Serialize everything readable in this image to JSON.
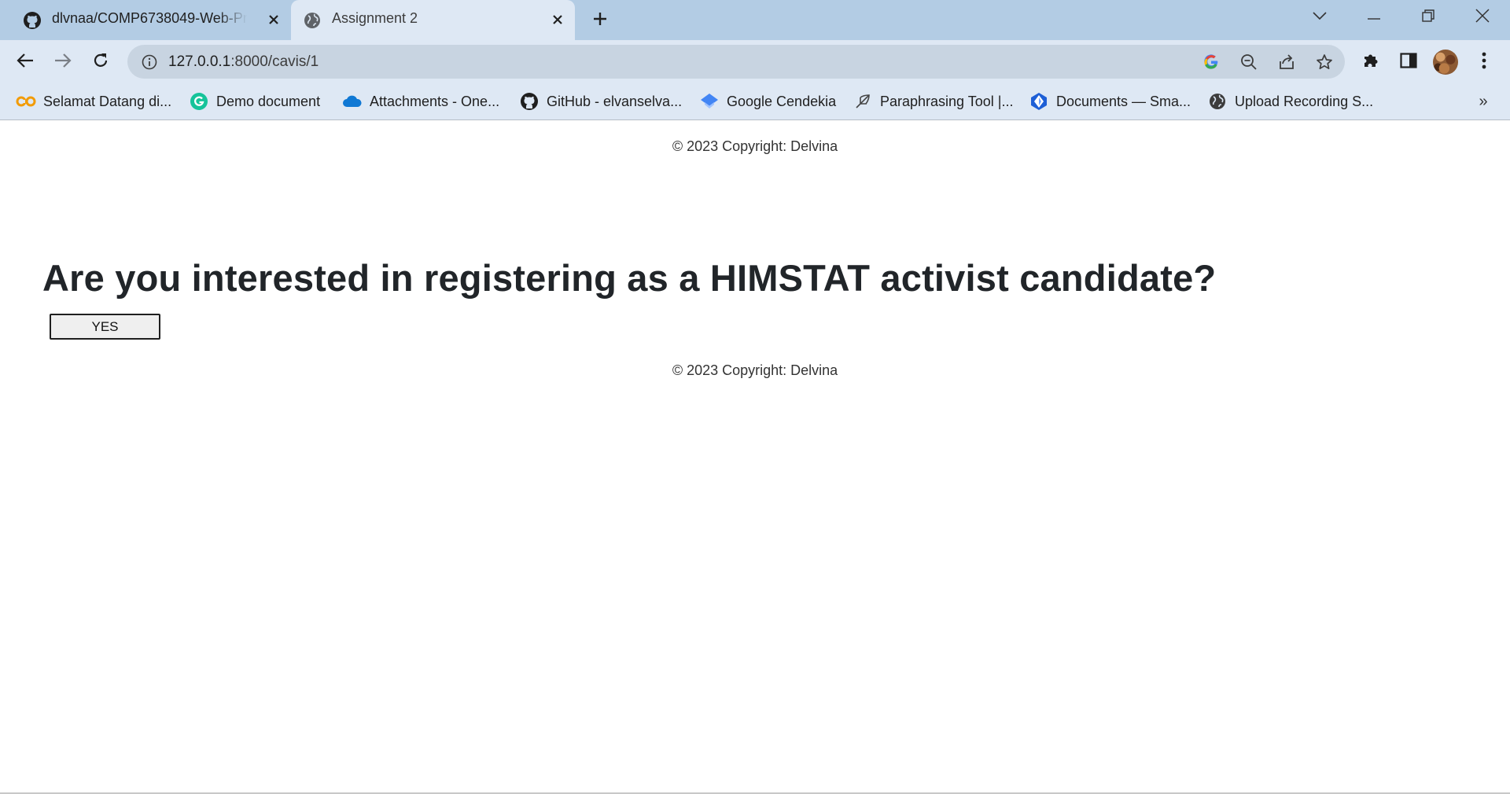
{
  "browser": {
    "tabs": [
      {
        "title": "dlvnaa/COMP6738049-Web-Programming",
        "favicon": "github-icon",
        "active": false
      },
      {
        "title": "Assignment 2",
        "favicon": "globe-icon",
        "active": true
      }
    ],
    "address_bar": {
      "host": "127.0.0.1",
      "rest": ":8000/cavis/1"
    },
    "bookmarks": [
      {
        "label": "Selamat Datang di...",
        "icon": "co-logo-icon"
      },
      {
        "label": "Demo document",
        "icon": "grammarly-icon"
      },
      {
        "label": "Attachments - One...",
        "icon": "onedrive-cloud-icon"
      },
      {
        "label": "GitHub - elvanselva...",
        "icon": "github-icon"
      },
      {
        "label": "Google Cendekia",
        "icon": "google-scholar-icon"
      },
      {
        "label": "Paraphrasing Tool |...",
        "icon": "feather-icon"
      },
      {
        "label": "Documents — Sma...",
        "icon": "smallpdf-icon"
      },
      {
        "label": "Upload Recording S...",
        "icon": "globe-icon"
      }
    ],
    "more_bookmarks": "»"
  },
  "page": {
    "footer_top": "© 2023 Copyright: Delvina",
    "question": "Are you interested in registering as a HIMSTAT activist candidate?",
    "yes_button": "YES",
    "footer_bottom": "© 2023 Copyright: Delvina"
  }
}
